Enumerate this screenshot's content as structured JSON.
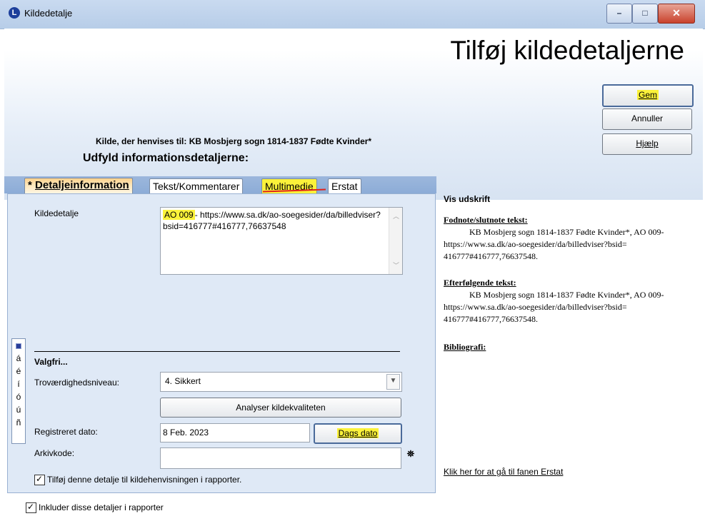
{
  "window": {
    "title": "Kildedetalje",
    "app_icon_letter": "L",
    "min_glyph": "–",
    "max_glyph": "□",
    "close_glyph": "✕"
  },
  "header": {
    "heading": "Tilføj kildedetaljerne"
  },
  "buttons": {
    "gem": "Gem",
    "annuller": "Annuller",
    "hjaelp": "Hjælp"
  },
  "source_ref": "Kilde, der henvises til: KB Mosbjerg sogn 1814-1837 Fødte Kvinder*",
  "fill_heading": "Udfyld informationsdetaljerne:",
  "tabs": [
    {
      "prefix": "* ",
      "label": "Detaljeinformation"
    },
    {
      "label": "Tekst/Kommentarer"
    },
    {
      "label": "Multimedie"
    },
    {
      "label": "Erstat"
    }
  ],
  "form": {
    "kildedetalje_label": "Kildedetalje",
    "kildedetalje_highlight": "AO 009",
    "kildedetalje_value_rest": "- https://www.sa.dk/ao-soegesider/da/billedviser?bsid=416777#416777,76637548",
    "side_letters": [
      "á",
      "é",
      "í",
      "ó",
      "ú",
      "ñ"
    ],
    "valgfri": "Valgfri...",
    "trov_label": "Troværdighedsniveau:",
    "trov_value": "4.  Sikkert",
    "analyse_button": "Analyser kildekvaliteten",
    "reg_label": "Registreret dato:",
    "reg_value": "8 Feb. 2023",
    "dags_button": "Dags dato",
    "arkiv_label": "Arkivkode:",
    "arkiv_value": "",
    "add_checkbox_label": "Tilføj denne detalje til kildehenvisningen i rapporter.",
    "include_checkbox_label": "Inkluder disse detaljer i rapporter",
    "binoculars_glyph": "⛯"
  },
  "preview": {
    "title": "Vis udskrift",
    "footnote_heading": "Fodnote/slutnote tekst:",
    "footnote_text": "KB Mosbjerg sogn 1814-1837 Fødte Kvinder*, AO 009- https://www.sa.dk/ao-soegesider/da/billedviser?bsid= 416777#416777,76637548.",
    "following_heading": "Efterfølgende tekst:",
    "following_text": "KB Mosbjerg sogn 1814-1837 Fødte Kvinder*, AO 009- https://www.sa.dk/ao-soegesider/da/billedviser?bsid= 416777#416777,76637548.",
    "biblio_heading": "Bibliografi:",
    "link": "Klik her for at gå til fanen Erstat"
  },
  "colors": {
    "highlight": "#fbf23a",
    "active_tab": "#ffd18a",
    "panel": "#dfe9f6"
  }
}
